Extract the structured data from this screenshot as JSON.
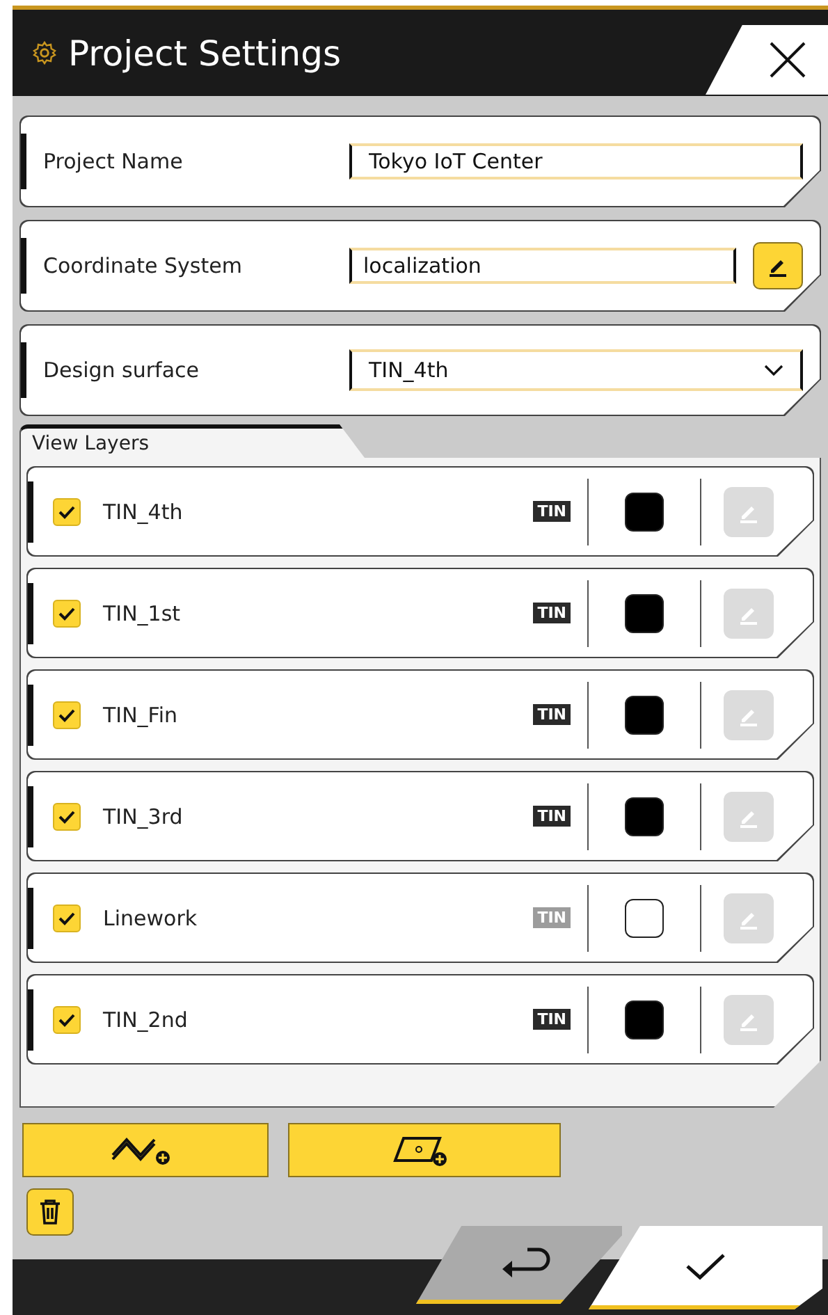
{
  "window": {
    "title": "Project Settings"
  },
  "fields": [
    {
      "kind": "text",
      "label": "Project Name",
      "value": "Tokyo IoT Center"
    },
    {
      "kind": "text_edit",
      "label": "Coordinate System",
      "value": "localization"
    },
    {
      "kind": "dropdown",
      "label": "Design surface",
      "value": "TIN_4th"
    }
  ],
  "view_layers": {
    "title": "View Layers",
    "layers": [
      {
        "name": "TIN_4th",
        "checked": true,
        "badge": "TIN",
        "badge_active": true,
        "color": "#000000",
        "edit_disabled": true
      },
      {
        "name": "TIN_1st",
        "checked": true,
        "badge": "TIN",
        "badge_active": true,
        "color": "#000000",
        "edit_disabled": true
      },
      {
        "name": "TIN_Fin",
        "checked": true,
        "badge": "TIN",
        "badge_active": true,
        "color": "#000000",
        "edit_disabled": true
      },
      {
        "name": "TIN_3rd",
        "checked": true,
        "badge": "TIN",
        "badge_active": true,
        "color": "#000000",
        "edit_disabled": true
      },
      {
        "name": "Linework",
        "checked": true,
        "badge": "TIN",
        "badge_active": false,
        "color": "#ffffff",
        "edit_disabled": true
      },
      {
        "name": "TIN_2nd",
        "checked": true,
        "badge": "TIN",
        "badge_active": true,
        "color": "#000000",
        "edit_disabled": true
      }
    ]
  }
}
